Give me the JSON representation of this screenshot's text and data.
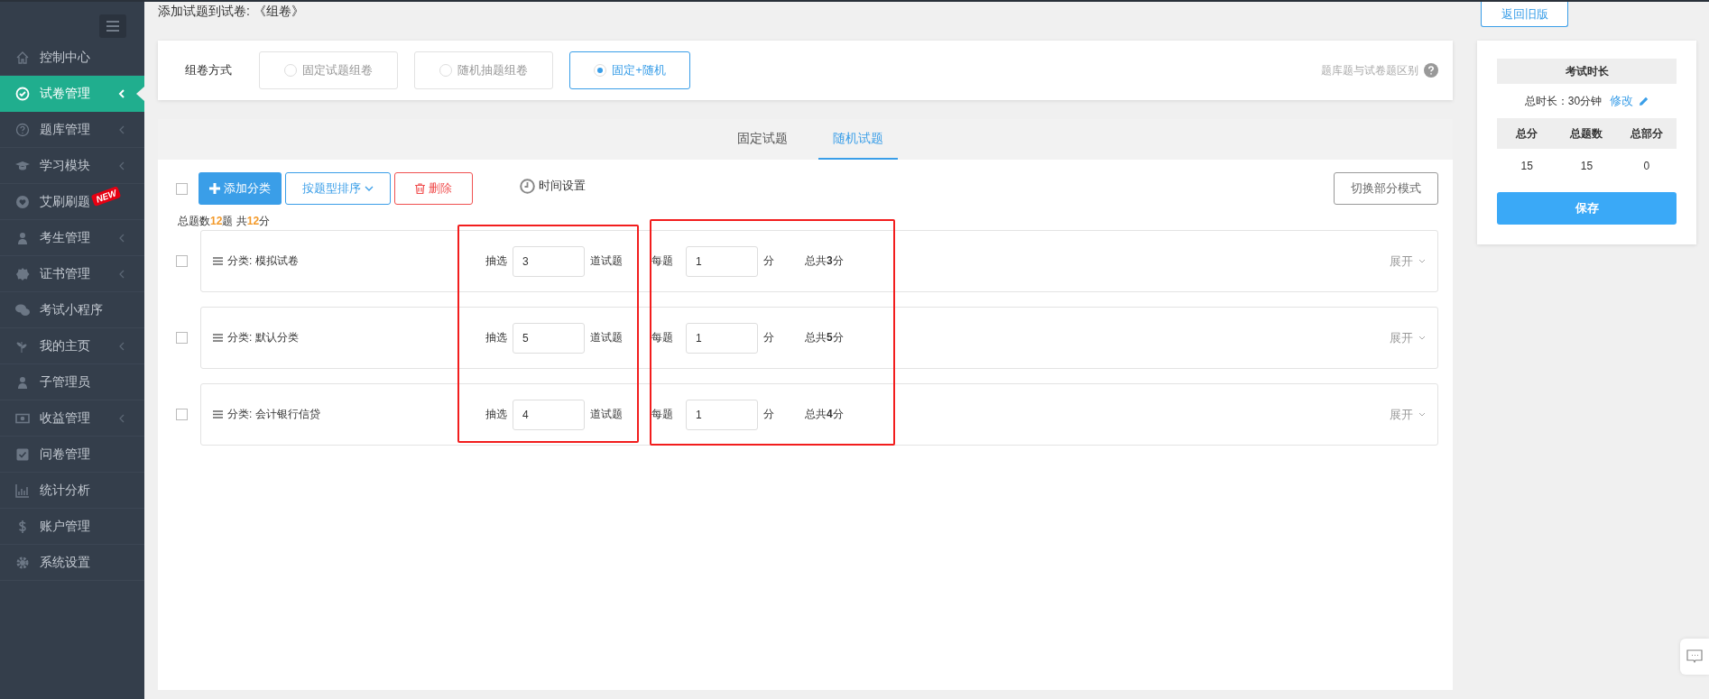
{
  "sidebar": {
    "items": [
      {
        "label": "控制中心",
        "selected": false,
        "has_arrow": false
      },
      {
        "label": "试卷管理",
        "selected": true,
        "has_arrow": true
      },
      {
        "label": "题库管理",
        "selected": false,
        "has_arrow": true
      },
      {
        "label": "学习模块",
        "selected": false,
        "has_arrow": true
      },
      {
        "label": "艾刷刷题",
        "selected": false,
        "has_arrow": false,
        "badge": "NEW"
      },
      {
        "label": "考生管理",
        "selected": false,
        "has_arrow": true
      },
      {
        "label": "证书管理",
        "selected": false,
        "has_arrow": true
      },
      {
        "label": "考试小程序",
        "selected": false,
        "has_arrow": false
      },
      {
        "label": "我的主页",
        "selected": false,
        "has_arrow": true
      },
      {
        "label": "子管理员",
        "selected": false,
        "has_arrow": false
      },
      {
        "label": "收益管理",
        "selected": false,
        "has_arrow": true
      },
      {
        "label": "问卷管理",
        "selected": false,
        "has_arrow": false
      },
      {
        "label": "统计分析",
        "selected": false,
        "has_arrow": false
      },
      {
        "label": "账户管理",
        "selected": false,
        "has_arrow": false
      },
      {
        "label": "系统设置",
        "selected": false,
        "has_arrow": false
      }
    ]
  },
  "page_title": "添加试题到试卷: 《组卷》",
  "back_button": "返回旧版",
  "compose_mode": {
    "label": "组卷方式",
    "options": [
      {
        "label": "固定试题组卷",
        "selected": false
      },
      {
        "label": "随机抽题组卷",
        "selected": false
      },
      {
        "label": "固定+随机",
        "selected": true
      }
    ],
    "help_link": "题库题与试卷题区别"
  },
  "tabs": [
    {
      "label": "固定试题",
      "selected": false
    },
    {
      "label": "随机试题",
      "selected": true
    }
  ],
  "toolbar": {
    "select_all_checked": false,
    "add_button": "添加分类",
    "sort_button": "按题型排序",
    "delete_button": "删除",
    "time_link": "时间设置",
    "switch_button": "切换部分模式"
  },
  "summary": "总题数**12**题 共**12**分",
  "categories": [
    {
      "checked": false,
      "name": "分类: 模拟试卷",
      "draw_label": "抽选",
      "draw_count": "3",
      "draw_unit": "道试题",
      "per_label": "每题",
      "per_score": "1",
      "per_unit": "分",
      "total": "总共**3**分",
      "expand": "展开"
    },
    {
      "checked": false,
      "name": "分类: 默认分类",
      "draw_label": "抽选",
      "draw_count": "5",
      "draw_unit": "道试题",
      "per_label": "每题",
      "per_score": "1",
      "per_unit": "分",
      "total": "总共**5**分",
      "expand": "展开"
    },
    {
      "checked": false,
      "name": "分类: 会计银行信贷",
      "draw_label": "抽选",
      "draw_count": "4",
      "draw_unit": "道试题",
      "per_label": "每题",
      "per_score": "1",
      "per_unit": "分",
      "total": "总共**4**分",
      "expand": "展开"
    }
  ],
  "exam_panel": {
    "title": "考试时长",
    "duration": "总时长：30分钟",
    "edit_link": "修改",
    "stats": [
      {
        "label": "总分",
        "value": "15"
      },
      {
        "label": "总题数",
        "value": "15"
      },
      {
        "label": "总部分",
        "value": "0"
      }
    ],
    "save_button": "保存"
  }
}
